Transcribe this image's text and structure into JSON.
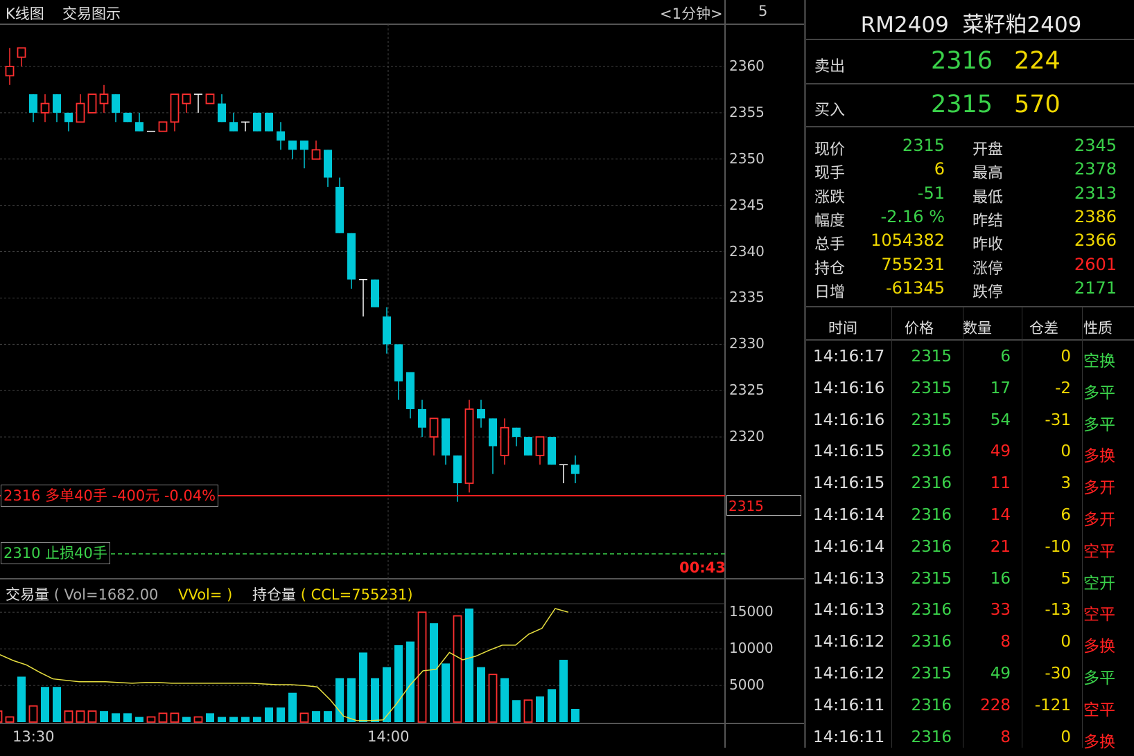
{
  "tabs": {
    "kline": "K线图",
    "trade": "交易图示",
    "period": "<1分钟>",
    "count": "5"
  },
  "colors": {
    "up": "#ff3030",
    "down": "#00c8d8",
    "green": "#3ad24a",
    "yellow": "#f0d800",
    "red": "#ff2020"
  },
  "price_axis": {
    "ticks": [
      "2360",
      "2355",
      "2350",
      "2345",
      "2340",
      "2335",
      "2330",
      "2325",
      "2320",
      "2315"
    ],
    "current": "2315"
  },
  "order_lines": {
    "long": "2316 多单40手 -400元 -0.04%",
    "stop": "2310 止损40手",
    "countdown": "00:43"
  },
  "volume_header": {
    "label": "交易量",
    "vol": "( Vol=1682.00",
    "vvol": "VVol= )",
    "ccl_label": "持仓量",
    "ccl": "( CCL=755231)"
  },
  "vol_axis": {
    "ticks": [
      "15000",
      "10000",
      "5000"
    ]
  },
  "time_axis": {
    "ticks": [
      "13:30",
      "14:00"
    ]
  },
  "chart_data": {
    "type": "candlestick",
    "ylim": [
      2309,
      2365
    ],
    "candles": [
      [
        2359,
        2360,
        2358,
        2362
      ],
      [
        2361,
        2362,
        2360,
        2362
      ],
      [
        2357,
        2355,
        2354,
        2357
      ],
      [
        2355,
        2356,
        2354,
        2357
      ],
      [
        2357,
        2355,
        2354,
        2357
      ],
      [
        2355,
        2354,
        2353,
        2355
      ],
      [
        2354,
        2356,
        2354,
        2357
      ],
      [
        2355,
        2357,
        2355,
        2357
      ],
      [
        2356,
        2357,
        2355,
        2358
      ],
      [
        2357,
        2355,
        2354,
        2357
      ],
      [
        2355,
        2354,
        2354,
        2355
      ],
      [
        2354,
        2353,
        2353,
        2355
      ],
      [
        2353,
        2353,
        2353,
        2353
      ],
      [
        2353,
        2354,
        2353,
        2354
      ],
      [
        2354,
        2357,
        2353,
        2357
      ],
      [
        2356,
        2357,
        2355,
        2357
      ],
      [
        2357,
        2357,
        2355,
        2357
      ],
      [
        2356,
        2357,
        2356,
        2357
      ],
      [
        2356,
        2354,
        2354,
        2357
      ],
      [
        2354,
        2353,
        2353,
        2355
      ],
      [
        2354,
        2354,
        2353,
        2354
      ],
      [
        2355,
        2353,
        2353,
        2355
      ],
      [
        2355,
        2353,
        2353,
        2355
      ],
      [
        2353,
        2352,
        2351,
        2354
      ],
      [
        2352,
        2351,
        2350,
        2352
      ],
      [
        2352,
        2351,
        2349,
        2352
      ],
      [
        2350,
        2351,
        2350,
        2352
      ],
      [
        2351,
        2348,
        2347,
        2351
      ],
      [
        2347,
        2342,
        2342,
        2348
      ],
      [
        2342,
        2337,
        2336,
        2342
      ],
      [
        2337,
        2337,
        2333,
        2337
      ],
      [
        2337,
        2334,
        2334,
        2337
      ],
      [
        2333,
        2330,
        2329,
        2334
      ],
      [
        2330,
        2326,
        2324,
        2330
      ],
      [
        2327,
        2323,
        2322,
        2327
      ],
      [
        2323,
        2321,
        2320,
        2324
      ],
      [
        2320,
        2322,
        2318,
        2322
      ],
      [
        2322,
        2318,
        2317,
        2322
      ],
      [
        2318,
        2315,
        2313,
        2318
      ],
      [
        2315,
        2323,
        2314,
        2324
      ],
      [
        2323,
        2322,
        2321,
        2324
      ],
      [
        2322,
        2319,
        2316,
        2322
      ],
      [
        2318,
        2321,
        2317,
        2322
      ],
      [
        2321,
        2320,
        2319,
        2321
      ],
      [
        2320,
        2318,
        2318,
        2320
      ],
      [
        2318,
        2320,
        2317,
        2320
      ],
      [
        2320,
        2317,
        2317,
        2320
      ],
      [
        2317,
        2317,
        2315,
        2317
      ],
      [
        2317,
        2316,
        2315,
        2318
      ]
    ],
    "volume": [
      1500,
      700,
      6200,
      2200,
      4800,
      4800,
      1500,
      1500,
      1500,
      1500,
      1200,
      1200,
      700,
      700,
      1200,
      1200,
      700,
      700,
      1200,
      700,
      700,
      700,
      700,
      2000,
      2000,
      4000,
      1200,
      1500,
      1500,
      6000,
      6000,
      9500,
      6000,
      7500,
      10500,
      11000,
      15000,
      13500,
      8000,
      14500,
      15500,
      7500,
      6500,
      6000,
      3000,
      3000,
      3500,
      4500,
      8500,
      1800
    ],
    "oi_line": [
      9200,
      8400,
      7800,
      6800,
      5900,
      5700,
      5500,
      5500,
      5500,
      5400,
      5300,
      5400,
      5400,
      5300,
      5300,
      5300,
      5300,
      5300,
      5300,
      5300,
      5200,
      5100,
      5100,
      5000,
      4800,
      3000,
      800,
      200,
      200,
      300,
      2500,
      5000,
      7000,
      7200,
      9500,
      8500,
      9000,
      9800,
      10500,
      10500,
      12000,
      12800,
      15500,
      15000
    ]
  },
  "quote": {
    "title": "RM2409  菜籽粕2409",
    "ask_label": "卖出",
    "ask_price": "2316",
    "ask_vol": "224",
    "bid_label": "买入",
    "bid_price": "2315",
    "bid_vol": "570",
    "rows": [
      {
        "l1": "现价",
        "v1": "2315",
        "l2": "开盘",
        "v2": "2345",
        "c1": "#3ad24a",
        "c2": "#3ad24a"
      },
      {
        "l1": "现手",
        "v1": "6",
        "l2": "最高",
        "v2": "2378",
        "c1": "#f0d800",
        "c2": "#3ad24a"
      },
      {
        "l1": "涨跌",
        "v1": "-51",
        "l2": "最低",
        "v2": "2313",
        "c1": "#3ad24a",
        "c2": "#3ad24a"
      },
      {
        "l1": "幅度",
        "v1": "-2.16 %",
        "l2": "昨结",
        "v2": "2386",
        "c1": "#3ad24a",
        "c2": "#f0d800"
      },
      {
        "l1": "总手",
        "v1": "1054382",
        "l2": "昨收",
        "v2": "2366",
        "c1": "#f0d800",
        "c2": "#f0d800"
      },
      {
        "l1": "持仓",
        "v1": "755231",
        "l2": "涨停",
        "v2": "2601",
        "c1": "#f0d800",
        "c2": "#ff2020"
      },
      {
        "l1": "日增",
        "v1": "-61345",
        "l2": "跌停",
        "v2": "2171",
        "c1": "#f0d800",
        "c2": "#3ad24a"
      }
    ],
    "tick_headers": [
      "时间",
      "价格",
      "数量",
      "仓差",
      "性质"
    ],
    "ticks": [
      {
        "t": "14:16:17",
        "p": "2315",
        "q": "6",
        "d": "0",
        "n": "空换",
        "qc": "#3ad24a",
        "nc": "#3ad24a"
      },
      {
        "t": "14:16:16",
        "p": "2315",
        "q": "17",
        "d": "-2",
        "n": "多平",
        "qc": "#3ad24a",
        "nc": "#3ad24a"
      },
      {
        "t": "14:16:16",
        "p": "2315",
        "q": "54",
        "d": "-31",
        "n": "多平",
        "qc": "#3ad24a",
        "nc": "#3ad24a"
      },
      {
        "t": "14:16:15",
        "p": "2316",
        "q": "49",
        "d": "0",
        "n": "多换",
        "qc": "#ff2020",
        "nc": "#ff2020"
      },
      {
        "t": "14:16:15",
        "p": "2316",
        "q": "11",
        "d": "3",
        "n": "多开",
        "qc": "#ff2020",
        "nc": "#ff2020"
      },
      {
        "t": "14:16:14",
        "p": "2316",
        "q": "14",
        "d": "6",
        "n": "多开",
        "qc": "#ff2020",
        "nc": "#ff2020"
      },
      {
        "t": "14:16:14",
        "p": "2316",
        "q": "21",
        "d": "-10",
        "n": "空平",
        "qc": "#ff2020",
        "nc": "#ff2020"
      },
      {
        "t": "14:16:13",
        "p": "2315",
        "q": "16",
        "d": "5",
        "n": "空开",
        "qc": "#3ad24a",
        "nc": "#3ad24a"
      },
      {
        "t": "14:16:13",
        "p": "2316",
        "q": "33",
        "d": "-13",
        "n": "空平",
        "qc": "#ff2020",
        "nc": "#ff2020"
      },
      {
        "t": "14:16:12",
        "p": "2316",
        "q": "8",
        "d": "0",
        "n": "多换",
        "qc": "#ff2020",
        "nc": "#ff2020"
      },
      {
        "t": "14:16:12",
        "p": "2315",
        "q": "49",
        "d": "-30",
        "n": "多平",
        "qc": "#3ad24a",
        "nc": "#3ad24a"
      },
      {
        "t": "14:16:11",
        "p": "2316",
        "q": "228",
        "d": "-121",
        "n": "空平",
        "qc": "#ff2020",
        "nc": "#ff2020"
      },
      {
        "t": "14:16:11",
        "p": "2316",
        "q": "8",
        "d": "0",
        "n": "多换",
        "qc": "#ff2020",
        "nc": "#ff2020"
      }
    ]
  }
}
